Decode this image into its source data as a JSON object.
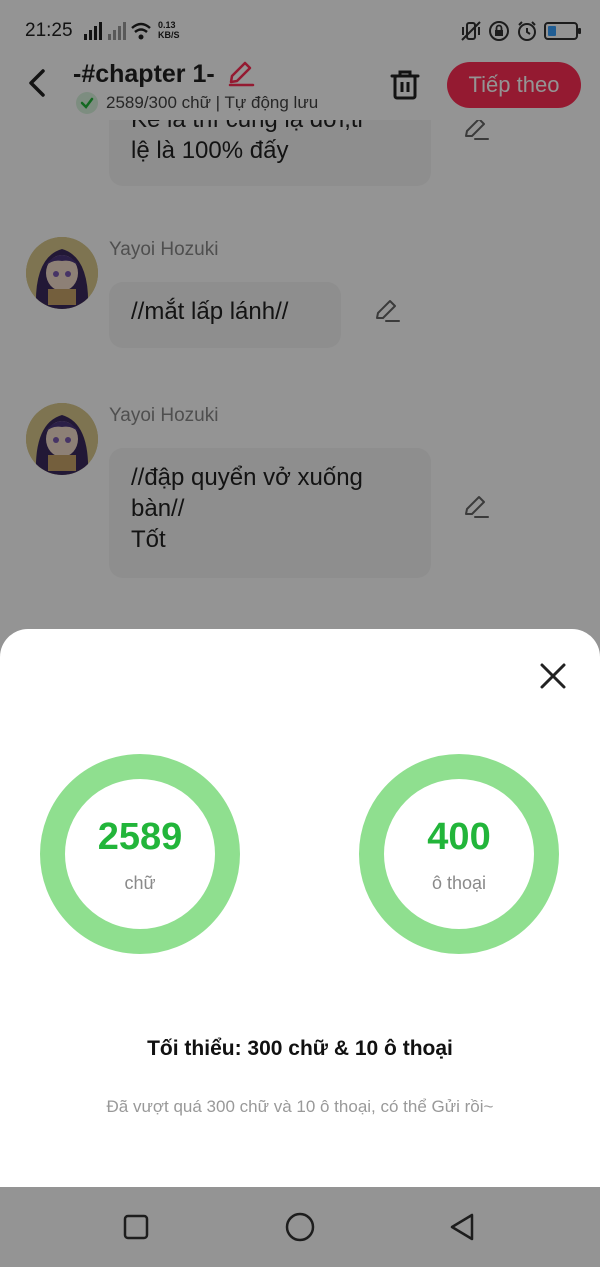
{
  "status_bar": {
    "time": "21:25",
    "net_speed_value": "0.13",
    "net_speed_unit": "KB/S",
    "battery_level": 0.3,
    "battery_color": "#3aa3ff"
  },
  "header": {
    "title": "-#chapter 1-",
    "save_status": "2589/300 chữ | Tự động lưu",
    "next_label": "Tiếp theo",
    "accent_color": "#ff2d55",
    "icons": [
      "back-arrow-icon",
      "pencil-icon",
      "check-icon",
      "trash-icon"
    ]
  },
  "chat": {
    "messages": [
      {
        "sender": "",
        "lines": [
          "Kể là thì cũng lạ đời,tỉ",
          "lệ là 100% đấy"
        ]
      },
      {
        "sender": "Yayoi Hozuki",
        "lines": [
          "//mắt lấp lánh//"
        ]
      },
      {
        "sender": "Yayoi Hozuki",
        "lines": [
          "//đập quyển vở xuống",
          "bàn//",
          "Tốt"
        ]
      }
    ]
  },
  "sheet": {
    "stats": [
      {
        "value": "2589",
        "unit": "chữ"
      },
      {
        "value": "400",
        "unit": "ô thoại"
      }
    ],
    "minimum": "Tối thiểu: 300 chữ & 10 ô thoại",
    "note": "Đã vượt quá 300 chữ và 10 ô thoại, có thể Gửi rồi~",
    "ring_color": "#8fdf8f",
    "value_color": "#22b53a"
  },
  "nav": {
    "icons": [
      "recents-square-icon",
      "home-circle-icon",
      "back-triangle-icon"
    ]
  }
}
